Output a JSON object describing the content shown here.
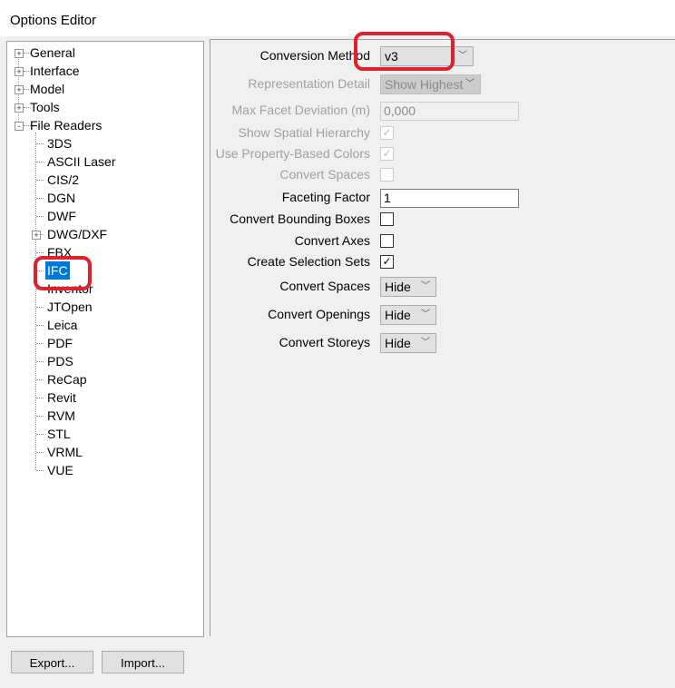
{
  "window": {
    "title": "Options Editor"
  },
  "tree": {
    "top": [
      {
        "label": "General",
        "expander": "+"
      },
      {
        "label": "Interface",
        "expander": "+"
      },
      {
        "label": "Model",
        "expander": "+"
      },
      {
        "label": "Tools",
        "expander": "+"
      },
      {
        "label": "File Readers",
        "expander": "-"
      }
    ],
    "children": [
      {
        "label": "3DS"
      },
      {
        "label": "ASCII Laser"
      },
      {
        "label": "CIS/2"
      },
      {
        "label": "DGN"
      },
      {
        "label": "DWF"
      },
      {
        "label": "DWG/DXF",
        "expander": "+"
      },
      {
        "label": "FBX"
      },
      {
        "label": "IFC",
        "selected": true
      },
      {
        "label": "Inventor"
      },
      {
        "label": "JTOpen"
      },
      {
        "label": "Leica"
      },
      {
        "label": "PDF"
      },
      {
        "label": "PDS"
      },
      {
        "label": "ReCap"
      },
      {
        "label": "Revit"
      },
      {
        "label": "RVM"
      },
      {
        "label": "STL"
      },
      {
        "label": "VRML"
      },
      {
        "label": "VUE"
      }
    ]
  },
  "settings": [
    {
      "label": "Conversion Method",
      "type": "dropdown",
      "value": "v3",
      "enabled": true
    },
    {
      "label": "Representation Detail",
      "type": "dropdown",
      "value": "Show Highest",
      "enabled": false
    },
    {
      "label": "Max Facet Deviation (m)",
      "type": "text",
      "value": "0,000",
      "enabled": false
    },
    {
      "label": "Show Spatial Hierarchy",
      "type": "checkbox",
      "checked": true,
      "enabled": false
    },
    {
      "label": "Use Property-Based Colors",
      "type": "checkbox",
      "checked": true,
      "enabled": false
    },
    {
      "label": "Convert Spaces",
      "type": "checkbox",
      "checked": false,
      "enabled": false
    },
    {
      "label": "Faceting Factor",
      "type": "text",
      "value": "1",
      "enabled": true
    },
    {
      "label": "Convert Bounding Boxes",
      "type": "checkbox",
      "checked": false,
      "enabled": true
    },
    {
      "label": "Convert Axes",
      "type": "checkbox",
      "checked": false,
      "enabled": true
    },
    {
      "label": "Create Selection Sets",
      "type": "checkbox",
      "checked": true,
      "enabled": true
    },
    {
      "label": "Convert Spaces",
      "type": "dropdown",
      "value": "Hide",
      "enabled": true
    },
    {
      "label": "Convert Openings",
      "type": "dropdown",
      "value": "Hide",
      "enabled": true
    },
    {
      "label": "Convert Storeys",
      "type": "dropdown",
      "value": "Hide",
      "enabled": true
    }
  ],
  "buttons": {
    "export": "Export...",
    "import": "Import..."
  },
  "colors": {
    "annotation": "#e0202a",
    "selection": "#0078d7"
  }
}
